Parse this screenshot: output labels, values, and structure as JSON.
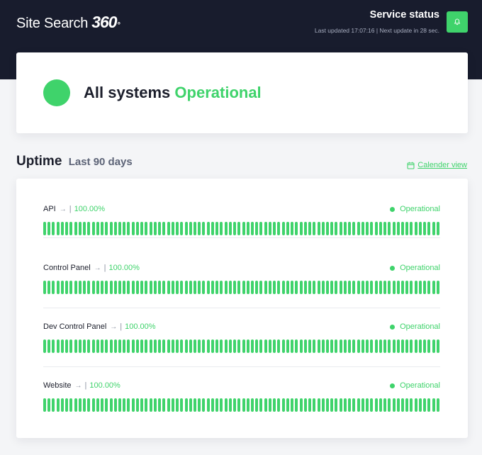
{
  "header": {
    "logo_text": "Site Search",
    "logo_mark": "360",
    "logo_deg": "°",
    "service_title": "Service status",
    "updated_text": "Last updated 17:07:16 | Next update in 28 sec.",
    "bell_icon": "bell-icon"
  },
  "status": {
    "prefix": "All systems",
    "state": "Operational",
    "color": "#3fd36b"
  },
  "uptime": {
    "title": "Uptime",
    "range": "Last 90 days",
    "calendar_link": "Calender view",
    "calendar_icon": "calendar-icon"
  },
  "components": [
    {
      "name": "API",
      "arrow": "→",
      "sep": "|",
      "uptime": "100.00%",
      "status": "Operational",
      "bar_count": 90
    },
    {
      "name": "Control Panel",
      "arrow": "→",
      "sep": "|",
      "uptime": "100.00%",
      "status": "Operational",
      "bar_count": 90
    },
    {
      "name": "Dev Control Panel",
      "arrow": "→",
      "sep": "|",
      "uptime": "100.00%",
      "status": "Operational",
      "bar_count": 90
    },
    {
      "name": "Website",
      "arrow": "→",
      "sep": "|",
      "uptime": "100.00%",
      "status": "Operational",
      "bar_count": 90
    }
  ],
  "colors": {
    "header_bg": "#181c2d",
    "accent": "#3fd36b",
    "page_bg": "#f4f5f7"
  }
}
